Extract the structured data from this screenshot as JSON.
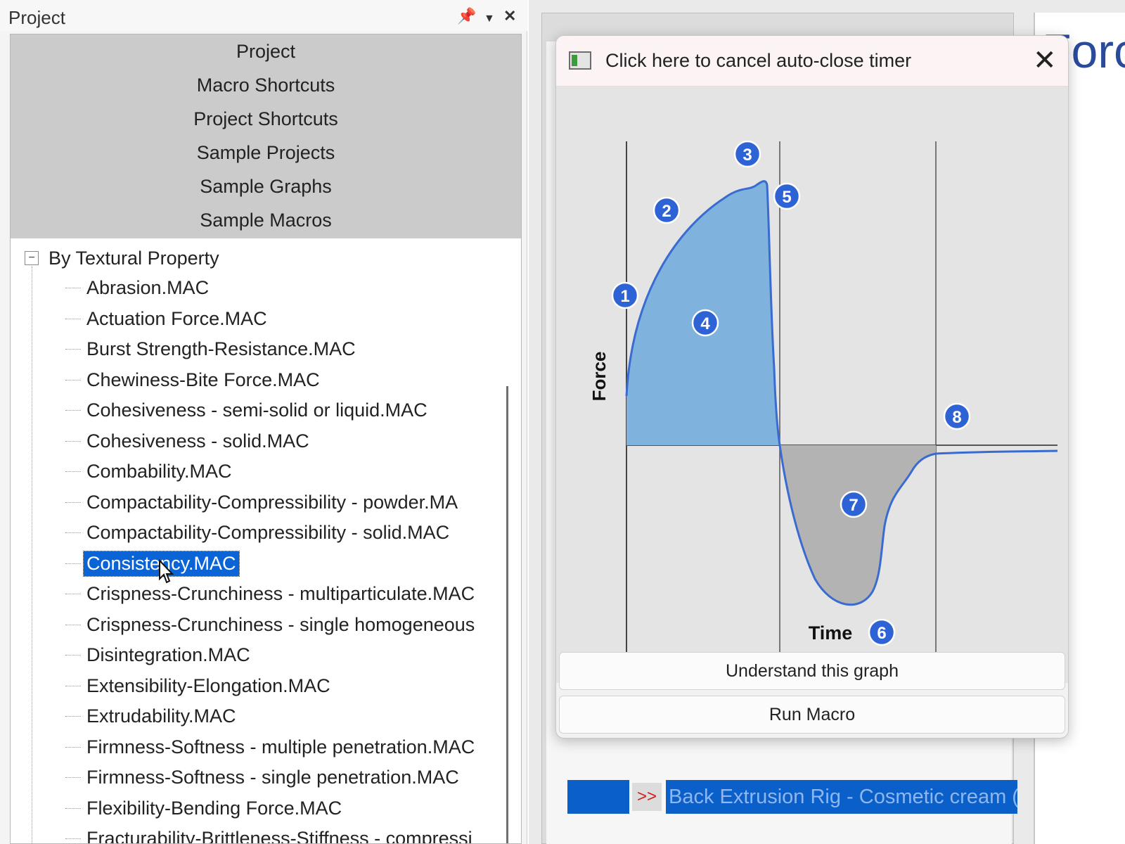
{
  "panel": {
    "title": "Project",
    "pin_icon": "pin-icon",
    "dropdown_icon": "chevron-down-icon",
    "close_icon": "close-icon",
    "categories": [
      "Project",
      "Macro Shortcuts",
      "Project Shortcuts",
      "Sample Projects",
      "Sample Graphs",
      "Sample Macros"
    ],
    "tree": {
      "root_label": "By Textural Property",
      "collapse_symbol": "−",
      "selected": "Consistency.MAC",
      "items": [
        "Abrasion.MAC",
        "Actuation Force.MAC",
        "Burst Strength-Resistance.MAC",
        "Chewiness-Bite Force.MAC",
        "Cohesiveness - semi-solid or liquid.MAC",
        "Cohesiveness - solid.MAC",
        "Combability.MAC",
        "Compactability-Compressibility - powder.MA",
        "Compactability-Compressibility - solid.MAC",
        "Consistency.MAC",
        "Crispness-Crunchiness - multiparticulate.MAC",
        "Crispness-Crunchiness - single homogeneous",
        "Disintegration.MAC",
        "Extensibility-Elongation.MAC",
        "Extrudability.MAC",
        "Firmness-Softness - multiple penetration.MAC",
        "Firmness-Softness - single penetration.MAC",
        "Flexibility-Bending Force.MAC",
        "Fracturability-Brittleness-Stiffness - compressi"
      ]
    }
  },
  "background": {
    "doc_title": "Forc",
    "macro_row_arrow": ">>",
    "macro_row_text": "Back Extrusion Rig - Cosmetic cream ("
  },
  "popup": {
    "title": "Click here to cancel auto-close timer",
    "window_icon": "window-icon",
    "close_icon": "close-icon",
    "understand_button": "Understand this graph",
    "run_button": "Run Macro"
  },
  "chart_data": {
    "type": "area",
    "xlabel": "Time",
    "ylabel": "Force",
    "positive_fill": "#7fb3dd",
    "negative_fill": "#b3b3b3",
    "line_color": "#3a6bd0",
    "markers": [
      "1",
      "2",
      "3",
      "4",
      "5",
      "6",
      "7",
      "8"
    ]
  }
}
